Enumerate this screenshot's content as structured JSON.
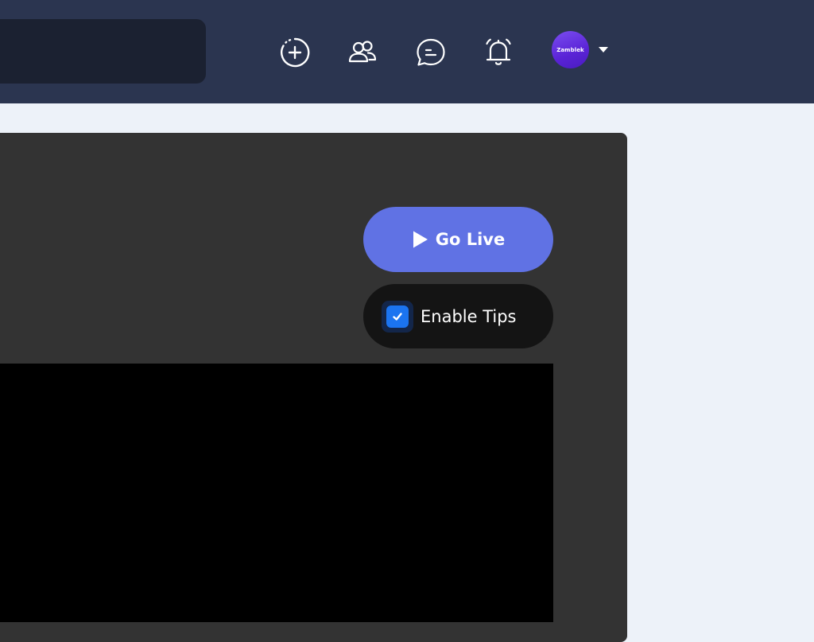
{
  "header": {
    "icons": [
      {
        "name": "create-icon"
      },
      {
        "name": "friends-icon"
      },
      {
        "name": "messages-icon"
      },
      {
        "name": "notifications-icon"
      }
    ],
    "user": {
      "avatar_text": "Zamblek"
    }
  },
  "stream": {
    "go_live_label": "Go Live",
    "enable_tips_label": "Enable Tips",
    "enable_tips_checked": true
  },
  "colors": {
    "topbar": "#2b3550",
    "accent": "#6072e4",
    "checkbox": "#1b74f0",
    "panel": "#333333"
  }
}
